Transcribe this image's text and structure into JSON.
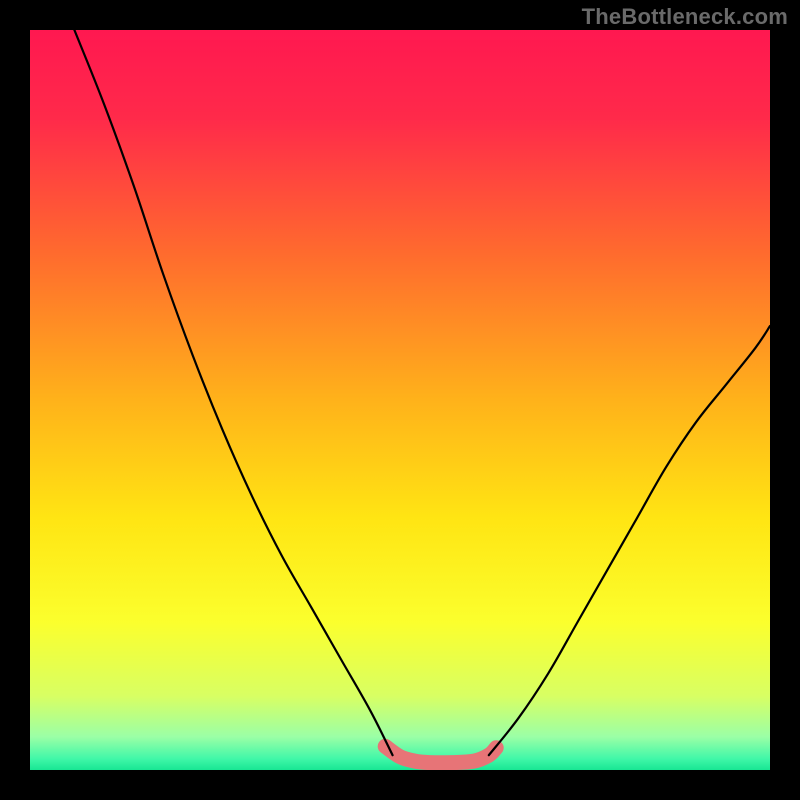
{
  "watermark": "TheBottleneck.com",
  "chart_data": {
    "type": "line",
    "title": "",
    "xlabel": "",
    "ylabel": "",
    "xlim": [
      0,
      100
    ],
    "ylim": [
      0,
      100
    ],
    "gradient_stops": [
      {
        "offset": 0.0,
        "color": "#ff1850"
      },
      {
        "offset": 0.12,
        "color": "#ff2a4a"
      },
      {
        "offset": 0.3,
        "color": "#ff6a2e"
      },
      {
        "offset": 0.5,
        "color": "#ffb21a"
      },
      {
        "offset": 0.66,
        "color": "#ffe513"
      },
      {
        "offset": 0.8,
        "color": "#fbff2d"
      },
      {
        "offset": 0.9,
        "color": "#d8ff63"
      },
      {
        "offset": 0.955,
        "color": "#9bffa6"
      },
      {
        "offset": 0.985,
        "color": "#40f7a8"
      },
      {
        "offset": 1.0,
        "color": "#18e693"
      }
    ],
    "series": [
      {
        "name": "left-curve",
        "color": "#000000",
        "width": 2.2,
        "x": [
          6,
          10,
          14,
          18,
          22,
          26,
          30,
          34,
          38,
          42,
          46,
          49
        ],
        "y": [
          100,
          90,
          79,
          67,
          56,
          46,
          37,
          29,
          22,
          15,
          8,
          2
        ]
      },
      {
        "name": "right-curve",
        "color": "#000000",
        "width": 2.2,
        "x": [
          62,
          66,
          70,
          74,
          78,
          82,
          86,
          90,
          94,
          98,
          100
        ],
        "y": [
          2,
          7,
          13,
          20,
          27,
          34,
          41,
          47,
          52,
          57,
          60
        ]
      },
      {
        "name": "bottom-highlight",
        "color": "#e77477",
        "width": 15,
        "x": [
          48,
          50,
          52,
          54,
          57,
          60,
          62,
          63
        ],
        "y": [
          3.2,
          1.8,
          1.2,
          1.0,
          1.0,
          1.2,
          2.0,
          3.0
        ]
      }
    ]
  }
}
